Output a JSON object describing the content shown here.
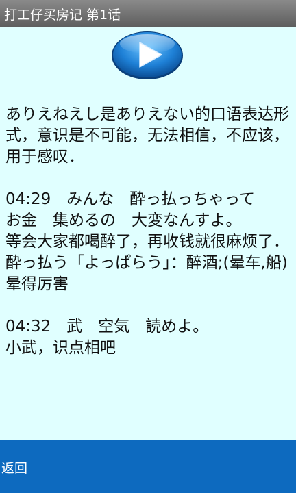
{
  "window": {
    "title": "打工仔买房记 第1话"
  },
  "player": {
    "icon": "play-icon"
  },
  "content": {
    "lines": [
      "ありえねえし是ありえない的口语表达形式，意识是不可能，无法相信，不应该，用于感叹．",
      "",
      "04:29　みんな　酔っ払っちゃって",
      "お金　集めるの　大変なんすよ。",
      "等会大家都喝醉了，再收钱就很麻烦了．",
      "酔っ払う「よっぱらう」：醉酒;(晕车,船)晕得厉害",
      "",
      "04:32　武　空気　読めよ。",
      "小武，识点相吧"
    ]
  },
  "footer": {
    "back_label": "返回"
  },
  "colors": {
    "background": "#e0ffff",
    "titlebar": "#6e6e6e",
    "footer": "#0d6abf",
    "play_button": "#1b7fd6"
  }
}
